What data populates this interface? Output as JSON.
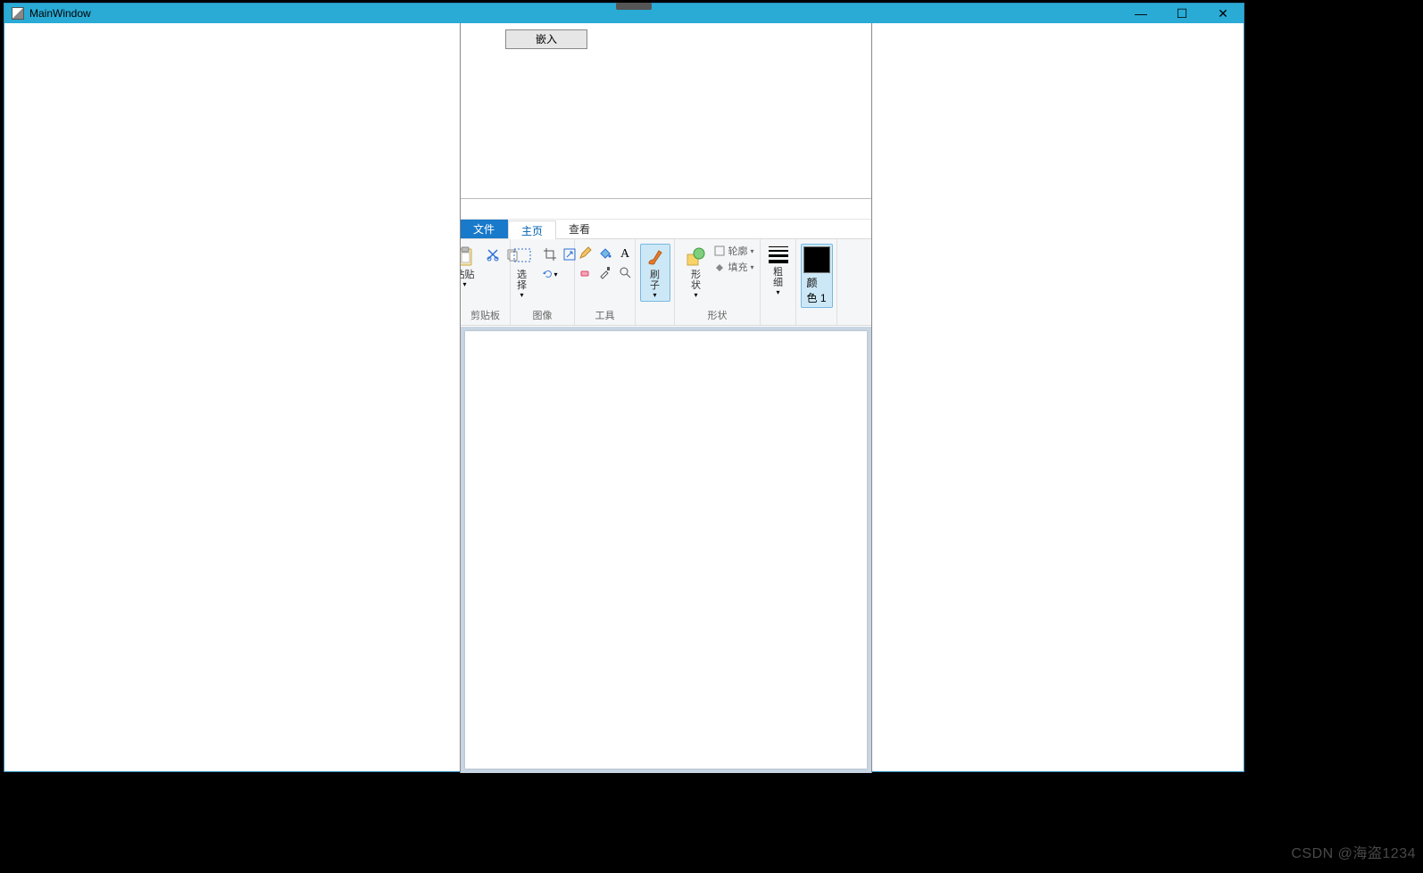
{
  "window": {
    "title": "MainWindow",
    "minimize": "—",
    "maximize": "☐",
    "close": "✕"
  },
  "top_panel": {
    "embed_button": "嵌入"
  },
  "paint": {
    "tabs": {
      "file": "文件",
      "home": "主页",
      "view": "查看"
    },
    "groups": {
      "clipboard": {
        "label": "剪贴板",
        "paste": "粘贴"
      },
      "image": {
        "label": "图像",
        "select": "选\n择"
      },
      "tools": {
        "label": "工具"
      },
      "brush": {
        "label": "刷\n子"
      },
      "shapes": {
        "label": "形状",
        "shape_btn": "形\n状",
        "outline": "轮廓",
        "fill": "填充"
      },
      "thickness": {
        "label": "粗\n细"
      },
      "color1": {
        "label": "颜\n色 1"
      }
    }
  },
  "watermark": "CSDN @海盗1234"
}
